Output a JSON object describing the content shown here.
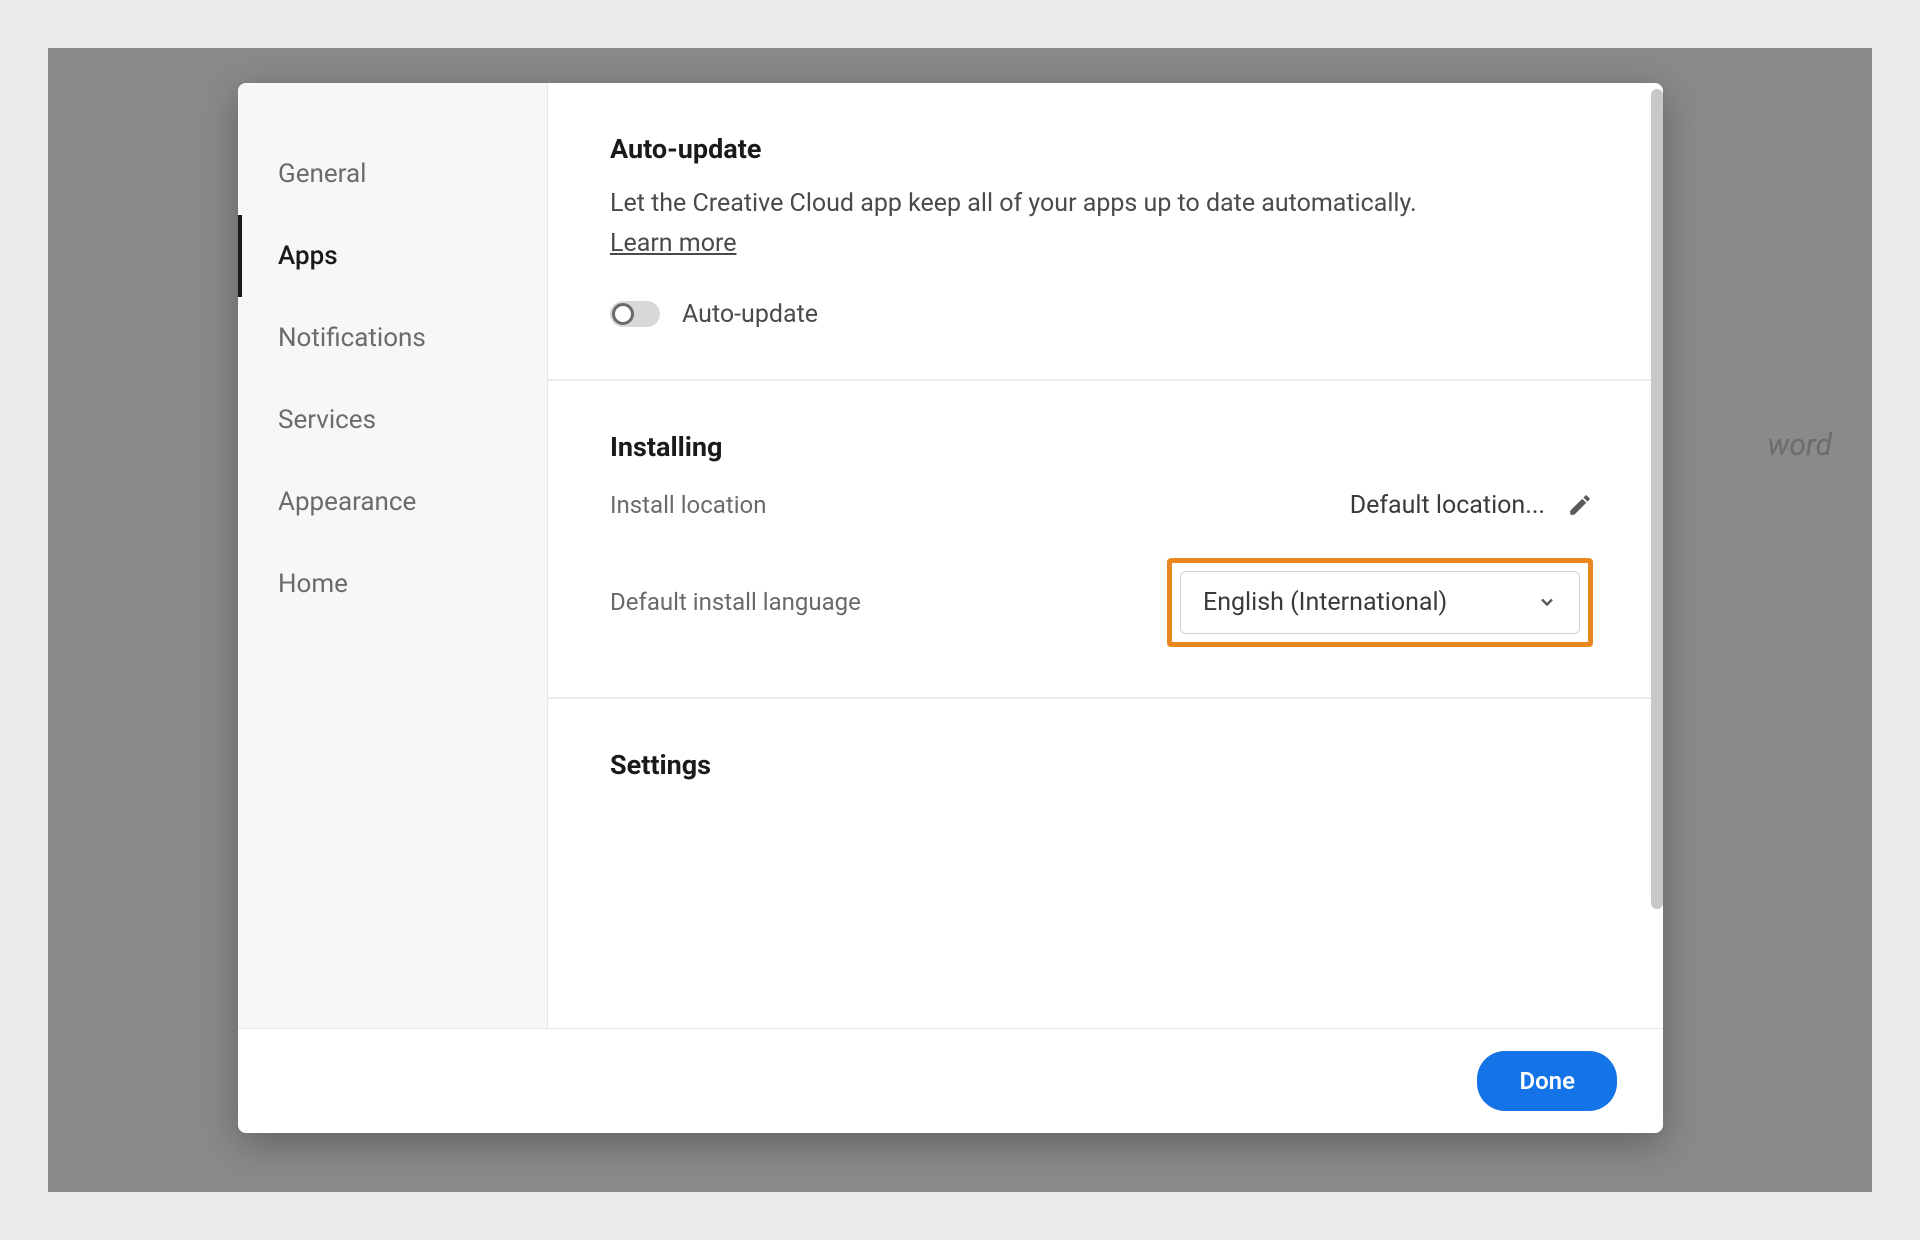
{
  "background": {
    "partial_text": "word"
  },
  "sidebar": {
    "items": [
      {
        "label": "General"
      },
      {
        "label": "Apps"
      },
      {
        "label": "Notifications"
      },
      {
        "label": "Services"
      },
      {
        "label": "Appearance"
      },
      {
        "label": "Home"
      }
    ]
  },
  "content": {
    "auto_update": {
      "title": "Auto-update",
      "description": "Let the Creative Cloud app keep all of your apps up to date automatically.",
      "learn_more": "Learn more",
      "toggle_label": "Auto-update",
      "toggle_state": "off"
    },
    "installing": {
      "title": "Installing",
      "location_label": "Install location",
      "location_value": "Default location...",
      "language_label": "Default install language",
      "language_value": "English (International)"
    },
    "settings": {
      "title": "Settings"
    }
  },
  "footer": {
    "done": "Done"
  },
  "highlight": {
    "color": "#e8871e"
  }
}
